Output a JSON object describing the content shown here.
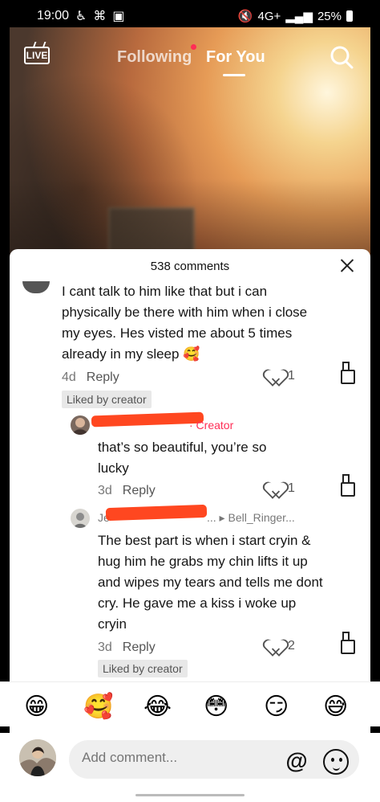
{
  "status": {
    "time": "19:00",
    "left_icons": [
      "accessibility-icon",
      "link-icon",
      "notification-box-icon"
    ],
    "network": "4G+",
    "battery": "25%"
  },
  "top_nav": {
    "live": "LIVE",
    "following": "Following",
    "for_you": "For You"
  },
  "comments_header": {
    "count": "538 comments"
  },
  "comments": [
    {
      "text": "I cant talk to him like that but i can physically be there with him when i close my eyes. Hes visted me about 5 times already in my sleep 🥰",
      "time": "4d",
      "reply": "Reply",
      "likes": "1",
      "badge": "Liked by creator"
    },
    {
      "author_suffix": "· Creator",
      "text": "that’s so beautiful, you’re so lucky",
      "time": "3d",
      "reply": "Reply",
      "likes": "1"
    },
    {
      "author_prefix": "Je",
      "author_suffix": "... ▸ Bell_Ringer...",
      "text": "The best part is when i start cryin & hug him he grabs my chin lifts it up and wipes my tears and tells me dont cry. He gave me a kiss i woke up cryin",
      "time": "3d",
      "reply": "Reply",
      "likes": "2",
      "badge": "Liked by creator"
    }
  ],
  "emojis": [
    "😁",
    "🥰",
    "😂",
    "😳",
    "😏",
    "😅"
  ],
  "composer": {
    "placeholder": "Add comment...",
    "at": "@"
  }
}
